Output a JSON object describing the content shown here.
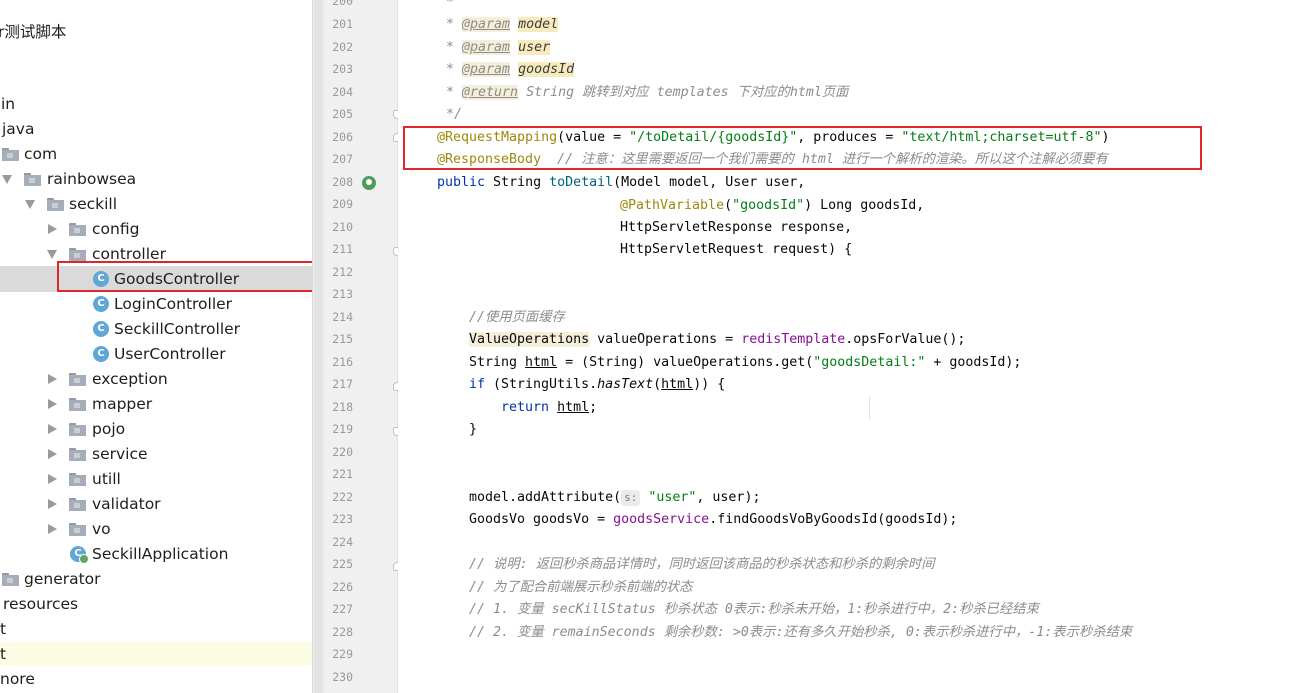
{
  "project_tree": {
    "items": [
      {
        "label": "r测试脚本",
        "type": "plain"
      },
      {
        "label": "in",
        "type": "plain"
      },
      {
        "label": "java",
        "type": "plain"
      },
      {
        "label": "com",
        "type": "folder"
      },
      {
        "label": "rainbowsea",
        "type": "folder"
      },
      {
        "label": "seckill",
        "type": "folder"
      },
      {
        "label": "config",
        "type": "folder"
      },
      {
        "label": "controller",
        "type": "folder"
      },
      {
        "label": "GoodsController",
        "type": "class"
      },
      {
        "label": "LoginController",
        "type": "class"
      },
      {
        "label": "SeckillController",
        "type": "class"
      },
      {
        "label": "UserController",
        "type": "class"
      },
      {
        "label": "exception",
        "type": "folder"
      },
      {
        "label": "mapper",
        "type": "folder"
      },
      {
        "label": "pojo",
        "type": "folder"
      },
      {
        "label": "service",
        "type": "folder"
      },
      {
        "label": "utill",
        "type": "folder"
      },
      {
        "label": "validator",
        "type": "folder"
      },
      {
        "label": "vo",
        "type": "folder"
      },
      {
        "label": "SeckillApplication",
        "type": "class"
      },
      {
        "label": "generator",
        "type": "folder"
      },
      {
        "label": "resources",
        "type": "plain"
      },
      {
        "label": "t",
        "type": "plain"
      },
      {
        "label": "t",
        "type": "plain"
      },
      {
        "label": "nore",
        "type": "plain"
      }
    ],
    "selected": "GoodsController",
    "class_icon_letter": "C"
  },
  "editor": {
    "line_numbers": [
      "200",
      "201",
      "202",
      "203",
      "204",
      "205",
      "206",
      "207",
      "208",
      "209",
      "210",
      "211",
      "212",
      "213",
      "214",
      "215",
      "216",
      "217",
      "218",
      "219",
      "220",
      "221",
      "222",
      "223",
      "224",
      "225",
      "226",
      "227",
      "228",
      "229",
      "230"
    ],
    "code": {
      "l200": "*",
      "l201_star": "* ",
      "l201_tag": "@param",
      "l201_name": "model",
      "l202_star": "* ",
      "l202_tag": "@param",
      "l202_name": "user",
      "l203_star": "* ",
      "l203_tag": "@param",
      "l203_name": "goodsId",
      "l204_star": "* ",
      "l204_tag": "@return",
      "l204_text": " String 跳转到对应 templates 下对应的html页面",
      "l205": "*/",
      "l206_anno": "@RequestMapping",
      "l206_a": "(value = ",
      "l206_s1": "\"/toDetail/{goodsId}\"",
      "l206_b": ", produces = ",
      "l206_s2": "\"text/html;charset=utf-8\"",
      "l206_c": ")",
      "l207_anno": "@ResponseBody",
      "l207_comment": "  // 注意：这里需要返回一个我们需要的 html 进行一个解析的渲染。所以这个注解必须要有",
      "l208_kw": "public",
      "l208_a": " String ",
      "l208_fn": "toDetail",
      "l208_b": "(Model model, User user,",
      "l209_anno": "@PathVariable",
      "l209_a": "(",
      "l209_s": "\"goodsId\"",
      "l209_b": ") Long goodsId,",
      "l210": "HttpServletResponse response,",
      "l211": "HttpServletRequest request) {",
      "l214": "//使用页面缓存",
      "l215_type": "ValueOperations",
      "l215_a": " valueOperations = ",
      "l215_fld": "redisTemplate",
      "l215_b": ".opsForValue();",
      "l216_a": "String ",
      "l216_var": "html",
      "l216_b": " = (String) valueOperations.get(",
      "l216_s": "\"goodsDetail:\"",
      "l216_c": " + goodsId);",
      "l217_kw": "if",
      "l217_a": " (StringUtils.",
      "l217_it": "hasText",
      "l217_b": "(",
      "l217_var": "html",
      "l217_c": ")) {",
      "l218_kw": "return",
      "l218_a": " ",
      "l218_var": "html",
      "l218_b": ";",
      "l219": "}",
      "l222_a": "model.addAttribute(",
      "l222_hint": "s:",
      "l222_s": " \"user\"",
      "l222_b": ", user);",
      "l223_a": "GoodsVo goodsVo = ",
      "l223_fld": "goodsService",
      "l223_b": ".findGoodsVoByGoodsId(goodsId);",
      "l225": "// 说明: 返回秒杀商品详情时，同时返回该商品的秒杀状态和秒杀的剩余时间",
      "l226": "// 为了配合前端展示秒杀前端的状态",
      "l227": "// 1. 变量 secKillStatus 秒杀状态 0表示:秒杀未开始，1:秒杀进行中，2:秒杀已经结束",
      "l228": "// 2. 变量 remainSeconds 剩余秒数: >0表示:还有多久开始秒杀, 0:表示秒杀进行中，-1:表示秒杀结束"
    }
  },
  "colors": {
    "annotation": "#9e880d",
    "string": "#067d17",
    "keyword": "#0033b3",
    "comment": "#8c8c8c",
    "highlight_box": "#e1262b",
    "selection": "#dadada"
  }
}
